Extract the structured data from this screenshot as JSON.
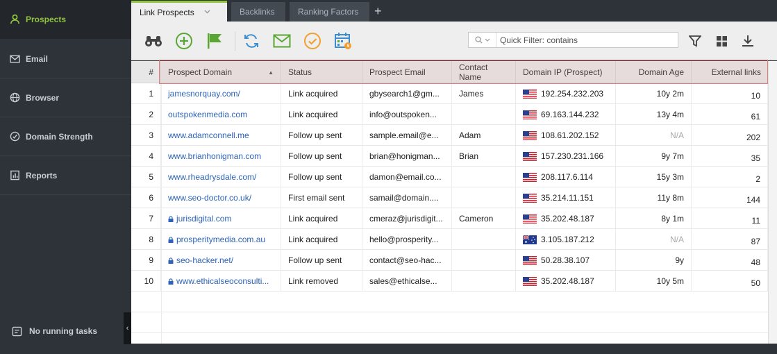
{
  "sidebar": {
    "items": [
      {
        "label": "Prospects",
        "icon": "user-icon",
        "active": true
      },
      {
        "label": "Email",
        "icon": "envelope-icon"
      },
      {
        "label": "Browser",
        "icon": "globe-icon"
      },
      {
        "label": "Domain Strength",
        "icon": "gauge-icon"
      },
      {
        "label": "Reports",
        "icon": "report-icon"
      }
    ],
    "status": "No running tasks",
    "collapse_glyph": "‹"
  },
  "tabs": [
    {
      "label": "Link Prospects",
      "active": true
    },
    {
      "label": "Backlinks"
    },
    {
      "label": "Ranking Factors"
    }
  ],
  "tab_add": "+",
  "toolbar": {
    "filter_placeholder": "Quick Filter: contains",
    "accent": "#8fc43f",
    "blue": "#3b8dd0",
    "orange": "#f0a030"
  },
  "grid": {
    "columns": [
      {
        "label": "#"
      },
      {
        "label": "Prospect Domain",
        "sort": "▲"
      },
      {
        "label": "Status"
      },
      {
        "label": "Prospect Email"
      },
      {
        "label": "Contact Name"
      },
      {
        "label": "Domain IP (Prospect)"
      },
      {
        "label": "Domain Age"
      },
      {
        "label": "External links"
      }
    ],
    "rows": [
      {
        "n": "1",
        "domain": "jamesnorquay.com/",
        "lock": false,
        "status": "Link acquired",
        "email": "gbysearch1@gm...",
        "contact": "James",
        "flag": "us",
        "ip": "192.254.232.203",
        "age": "10y 2m",
        "links": "10"
      },
      {
        "n": "2",
        "domain": "outspokenmedia.com",
        "lock": false,
        "status": "Link acquired",
        "email": "info@outspoken...",
        "contact": "",
        "flag": "us",
        "ip": "69.163.144.232",
        "age": "13y 4m",
        "links": "61"
      },
      {
        "n": "3",
        "domain": "www.adamconnell.me",
        "lock": false,
        "status": "Follow up sent",
        "email": "sample.email@e...",
        "contact": "Adam",
        "flag": "us",
        "ip": "108.61.202.152",
        "age": "N/A",
        "links": "202"
      },
      {
        "n": "4",
        "domain": "www.brianhonigman.com",
        "lock": false,
        "status": "Follow up sent",
        "email": "brian@honigman...",
        "contact": "Brian",
        "flag": "us",
        "ip": "157.230.231.166",
        "age": "9y 7m",
        "links": "35"
      },
      {
        "n": "5",
        "domain": "www.rheadrysdale.com/",
        "lock": false,
        "status": "Follow up sent",
        "email": "damon@email.co...",
        "contact": "",
        "flag": "us",
        "ip": "208.117.6.114",
        "age": "15y 3m",
        "links": "2"
      },
      {
        "n": "6",
        "domain": "www.seo-doctor.co.uk/",
        "lock": false,
        "status": "First email sent",
        "email": "samail@domain....",
        "contact": "",
        "flag": "us",
        "ip": "35.214.11.151",
        "age": "11y 8m",
        "links": "144"
      },
      {
        "n": "7",
        "domain": "jurisdigital.com",
        "lock": true,
        "status": "Link acquired",
        "email": "cmeraz@jurisdigit...",
        "contact": "Cameron",
        "flag": "us",
        "ip": "35.202.48.187",
        "age": "8y 1m",
        "links": "11"
      },
      {
        "n": "8",
        "domain": "prosperitymedia.com.au",
        "lock": true,
        "status": "Link acquired",
        "email": "hello@prosperity...",
        "contact": "",
        "flag": "au",
        "ip": "3.105.187.212",
        "age": "N/A",
        "links": "87"
      },
      {
        "n": "9",
        "domain": "seo-hacker.net/",
        "lock": true,
        "status": "Follow up sent",
        "email": "contact@seo-hac...",
        "contact": "",
        "flag": "us",
        "ip": "50.28.38.107",
        "age": "9y",
        "links": "48"
      },
      {
        "n": "10",
        "domain": "www.ethicalseoconsulti...",
        "lock": true,
        "status": "Link removed",
        "email": "sales@ethicalse...",
        "contact": "",
        "flag": "us",
        "ip": "35.202.48.187",
        "age": "10y 5m",
        "links": "50"
      }
    ]
  }
}
